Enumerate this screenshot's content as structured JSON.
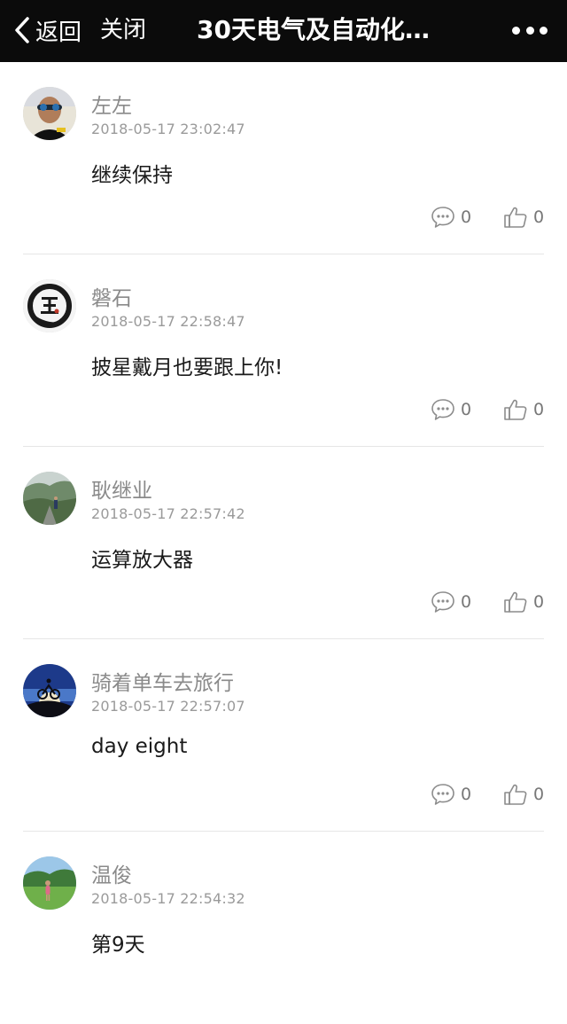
{
  "nav": {
    "back_label": "返回",
    "close_label": "关闭",
    "title": "30天电气及自动化…",
    "more_icon": "more-dots-icon",
    "back_icon": "chevron-left-icon"
  },
  "colors": {
    "nav_background": "#0b0b0b",
    "name_text": "#8a8a8a",
    "timestamp_text": "#9a9a9a",
    "divider": "#e6e6e6"
  },
  "comments": [
    {
      "name": "左左",
      "time": "2018-05-17 23:02:47",
      "content": "继续保持",
      "reply_count": "0",
      "like_count": "0"
    },
    {
      "name": "磐石",
      "time": "2018-05-17 22:58:47",
      "content": "披星戴月也要跟上你!",
      "reply_count": "0",
      "like_count": "0"
    },
    {
      "name": "耿继业",
      "time": "2018-05-17 22:57:42",
      "content": "运算放大器",
      "reply_count": "0",
      "like_count": "0"
    },
    {
      "name": "骑着单车去旅行",
      "time": "2018-05-17 22:57:07",
      "content": "day eight",
      "reply_count": "0",
      "like_count": "0"
    },
    {
      "name": "温俊",
      "time": "2018-05-17 22:54:32",
      "content": "第9天",
      "reply_count": "0",
      "like_count": "0"
    }
  ]
}
